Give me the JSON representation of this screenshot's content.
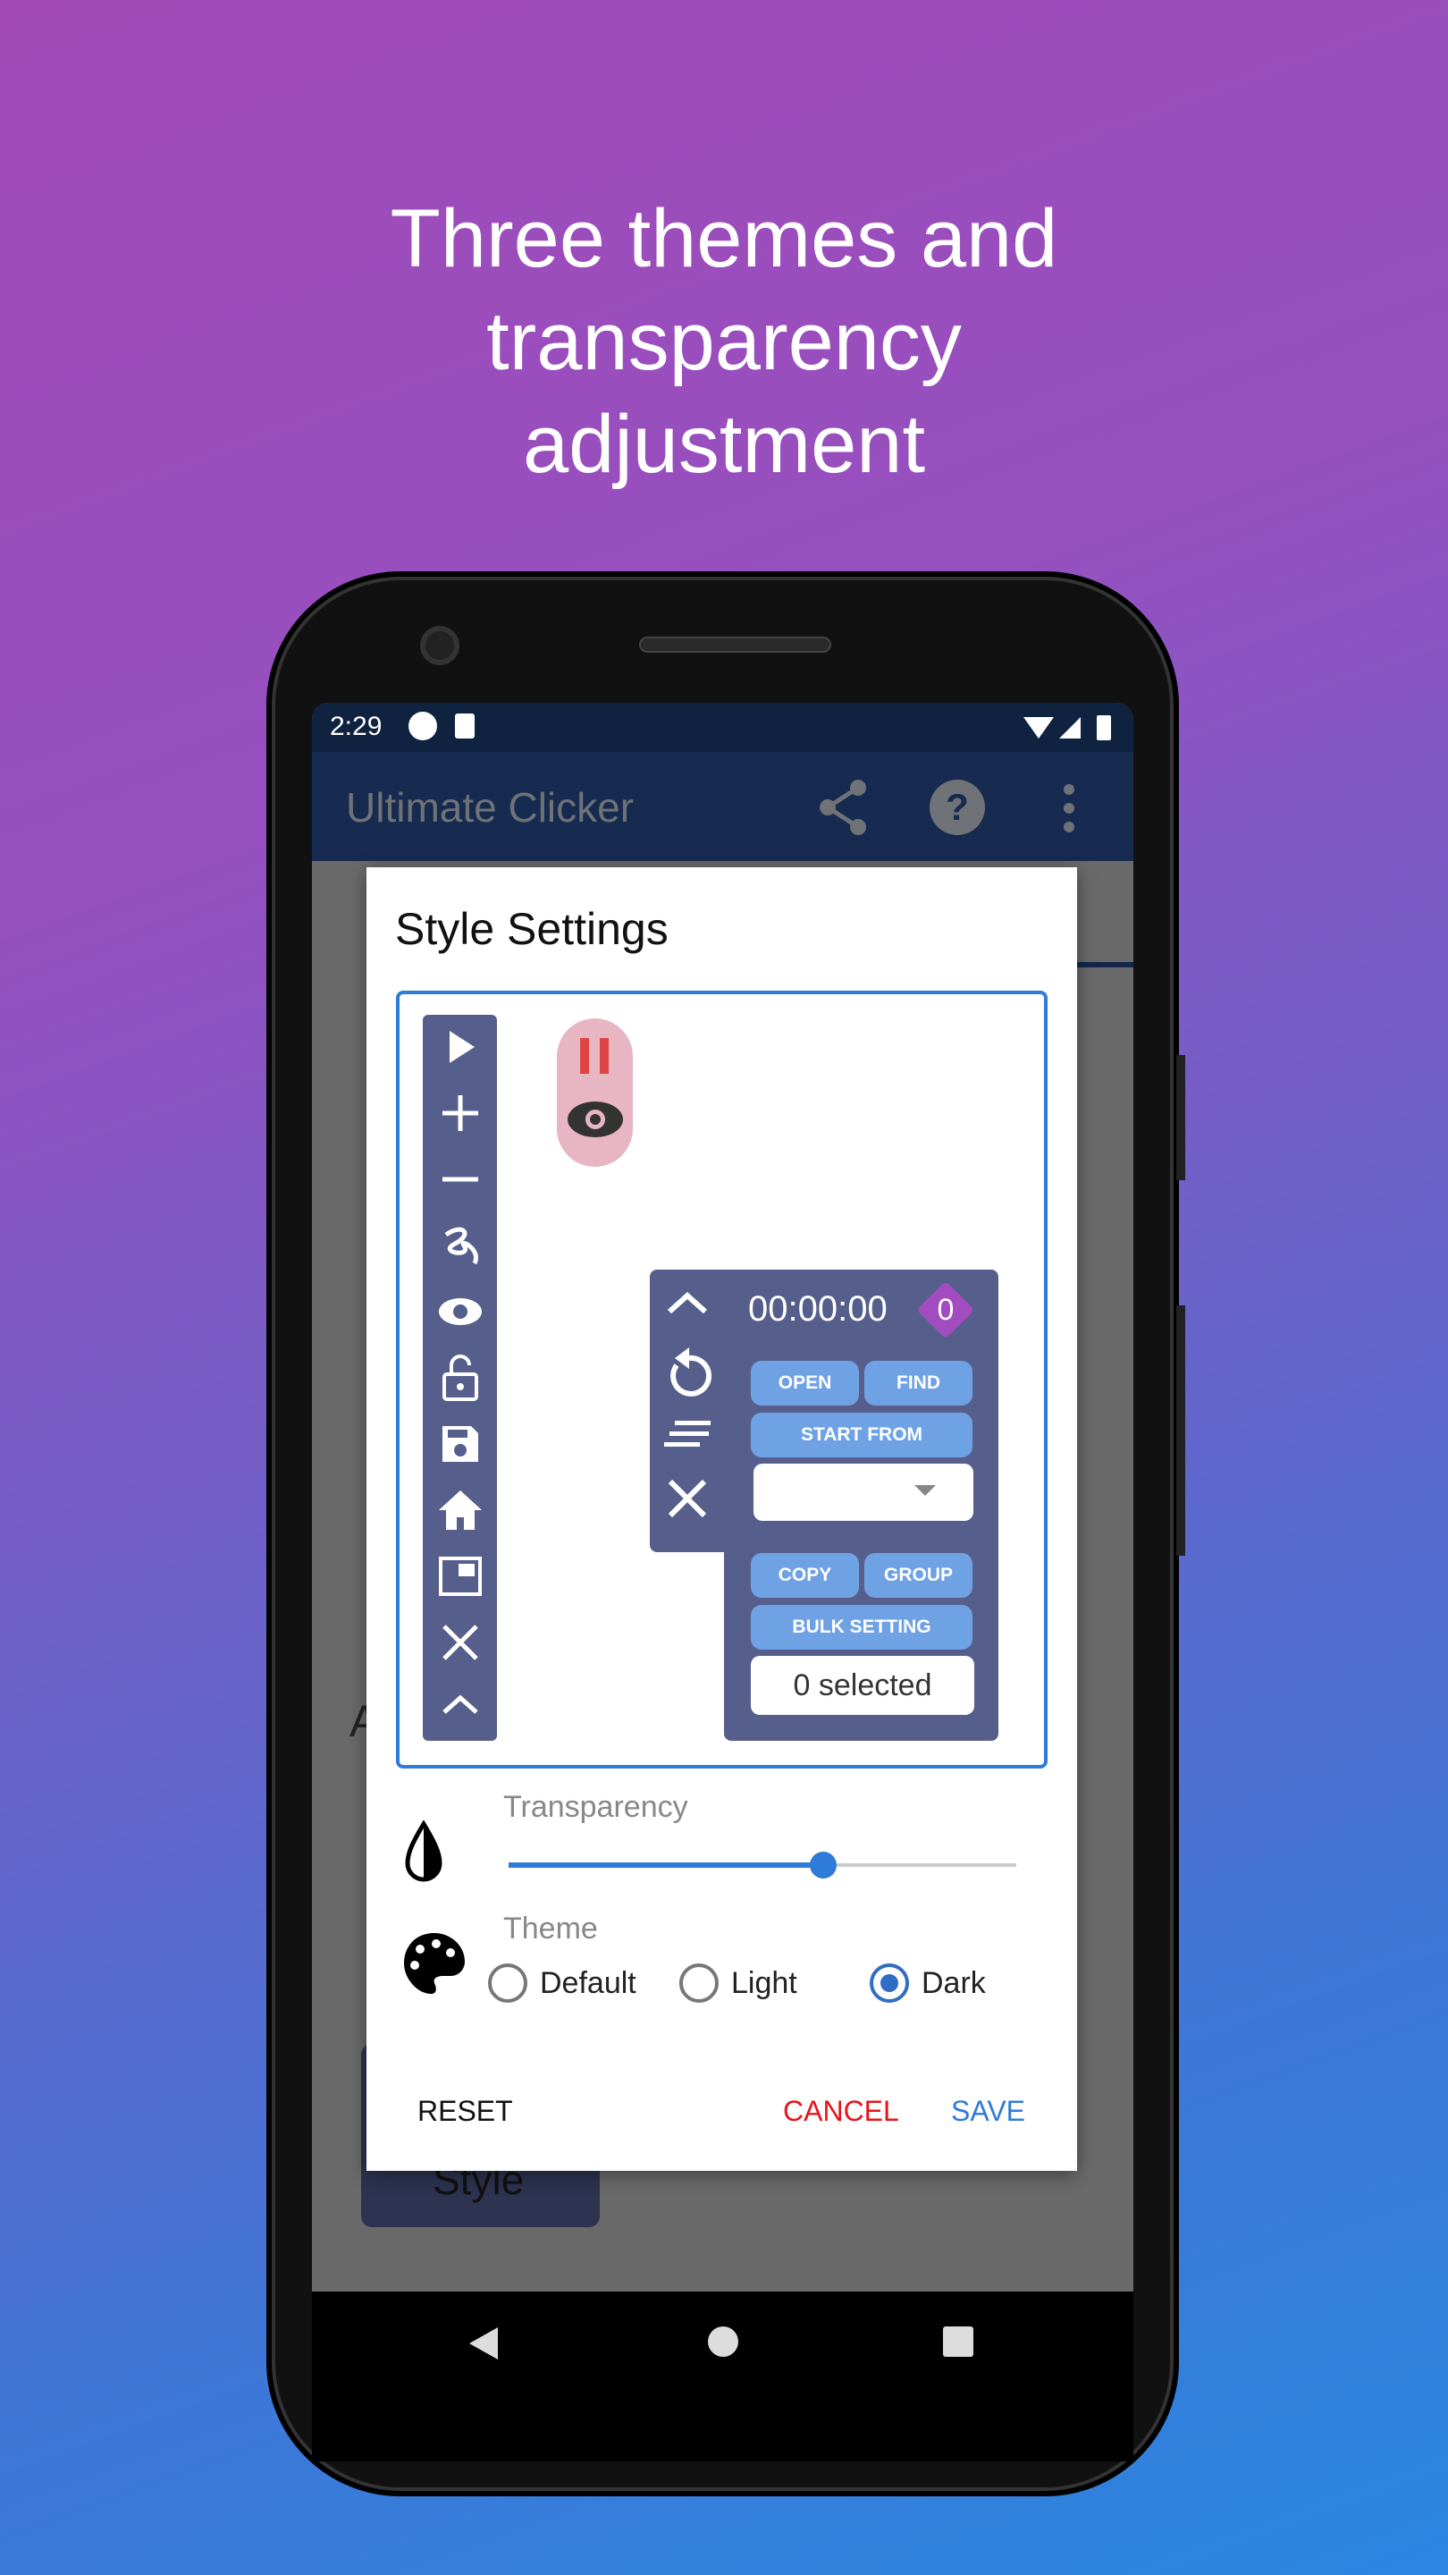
{
  "headline": [
    "Three themes and",
    "transparency",
    "adjustment"
  ],
  "status_bar": {
    "time": "2:29"
  },
  "app_bar": {
    "title": "Ultimate Clicker",
    "icons": [
      "share-icon",
      "help-icon",
      "more-vert-icon"
    ]
  },
  "background": {
    "partial_text": "A",
    "style_button": "Style"
  },
  "dialog": {
    "title": "Style Settings",
    "preview": {
      "toolbar_icons": [
        "play-icon",
        "plus-icon",
        "minus-icon",
        "swipe-icon",
        "eye-icon",
        "unlock-icon",
        "save-icon",
        "home-icon",
        "picture-in-picture-icon",
        "close-icon",
        "chevron-up-icon"
      ],
      "timer": "00:00:00",
      "target_count": "0",
      "buttons": {
        "open": "OPEN",
        "find": "FIND",
        "start_from": "START  FROM",
        "copy": "COPY",
        "group": "GROUP",
        "bulk_setting": "BULK SETTING"
      },
      "selected": "0 selected"
    },
    "transparency": {
      "label": "Transparency",
      "value": 0.62
    },
    "theme": {
      "label": "Theme",
      "options": [
        "Default",
        "Light",
        "Dark"
      ],
      "selected": "Dark"
    },
    "actions": {
      "reset": "RESET",
      "cancel": "CANCEL",
      "save": "SAVE"
    }
  },
  "colors": {
    "accent": "#2f7bd8",
    "cancel": "#e8141c",
    "panel": "#565f8c",
    "button": "#6fa2e4",
    "pill": "#e8b5c3",
    "target": "#a24cc0"
  }
}
